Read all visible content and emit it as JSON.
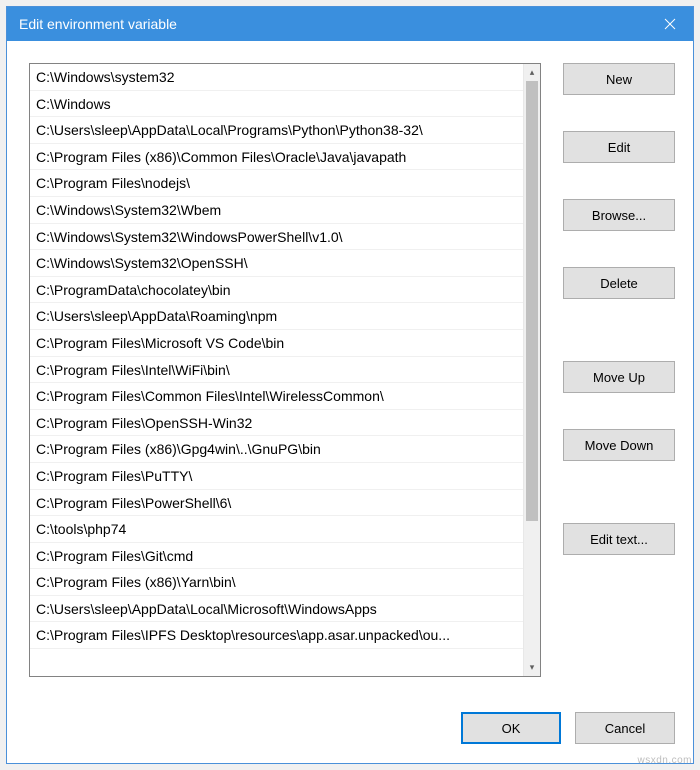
{
  "window": {
    "title": "Edit environment variable"
  },
  "paths": [
    "C:\\Windows\\system32",
    "C:\\Windows",
    "C:\\Users\\sleep\\AppData\\Local\\Programs\\Python\\Python38-32\\",
    "C:\\Program Files (x86)\\Common Files\\Oracle\\Java\\javapath",
    "C:\\Program Files\\nodejs\\",
    "C:\\Windows\\System32\\Wbem",
    "C:\\Windows\\System32\\WindowsPowerShell\\v1.0\\",
    "C:\\Windows\\System32\\OpenSSH\\",
    "C:\\ProgramData\\chocolatey\\bin",
    "C:\\Users\\sleep\\AppData\\Roaming\\npm",
    "C:\\Program Files\\Microsoft VS Code\\bin",
    "C:\\Program Files\\Intel\\WiFi\\bin\\",
    "C:\\Program Files\\Common Files\\Intel\\WirelessCommon\\",
    "C:\\Program Files\\OpenSSH-Win32",
    "C:\\Program Files (x86)\\Gpg4win\\..\\GnuPG\\bin",
    "C:\\Program Files\\PuTTY\\",
    "C:\\Program Files\\PowerShell\\6\\",
    "C:\\tools\\php74",
    "C:\\Program Files\\Git\\cmd",
    "C:\\Program Files (x86)\\Yarn\\bin\\",
    "C:\\Users\\sleep\\AppData\\Local\\Microsoft\\WindowsApps",
    "C:\\Program Files\\IPFS Desktop\\resources\\app.asar.unpacked\\ou..."
  ],
  "buttons": {
    "new": "New",
    "edit": "Edit",
    "browse": "Browse...",
    "delete": "Delete",
    "move_up": "Move Up",
    "move_down": "Move Down",
    "edit_text": "Edit text...",
    "ok": "OK",
    "cancel": "Cancel"
  },
  "watermark": "wsxdn.com"
}
